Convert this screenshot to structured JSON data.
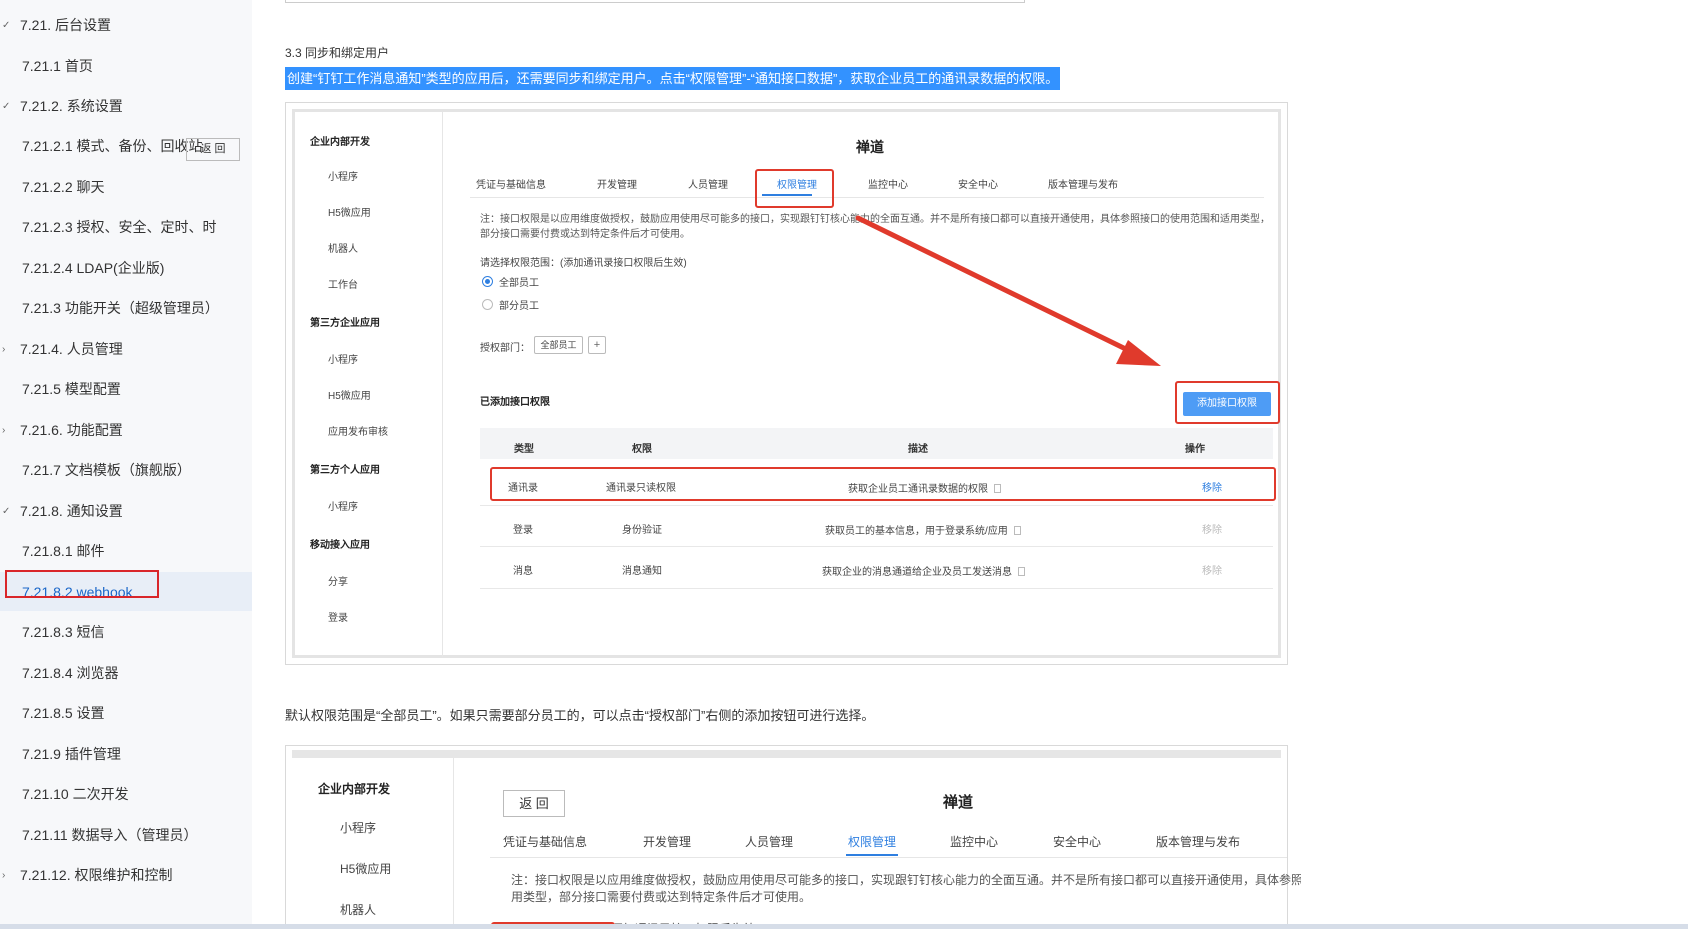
{
  "sidebar": {
    "items": [
      {
        "label": "7.21.  后台设置",
        "level": 1,
        "chevron": "✓"
      },
      {
        "label": "7.21.1  首页",
        "level": 2
      },
      {
        "label": "7.21.2.  系统设置",
        "level": 1,
        "chevron": "✓"
      },
      {
        "label": "7.21.2.1  模式、备份、回收站",
        "level": 2
      },
      {
        "label": "7.21.2.2  聊天",
        "level": 2
      },
      {
        "label": "7.21.2.3  授权、安全、定时、时",
        "level": 2
      },
      {
        "label": "7.21.2.4  LDAP(企业版)",
        "level": 2
      },
      {
        "label": "7.21.3  功能开关（超级管理员）",
        "level": 2
      },
      {
        "label": "7.21.4.  人员管理",
        "level": 1,
        "chevron": "›"
      },
      {
        "label": "7.21.5  模型配置",
        "level": 2
      },
      {
        "label": "7.21.6.  功能配置",
        "level": 1,
        "chevron": "›"
      },
      {
        "label": "7.21.7  文档模板（旗舰版）",
        "level": 2
      },
      {
        "label": "7.21.8.  通知设置",
        "level": 1,
        "chevron": "✓"
      },
      {
        "label": "7.21.8.1  邮件",
        "level": 2
      },
      {
        "label": "7.21.8.2  webhook",
        "level": 2,
        "active": true
      },
      {
        "label": "7.21.8.3  短信",
        "level": 2
      },
      {
        "label": "7.21.8.4  浏览器",
        "level": 2
      },
      {
        "label": "7.21.8.5  设置",
        "level": 2
      },
      {
        "label": "7.21.9  插件管理",
        "level": 2
      },
      {
        "label": "7.21.10  二次开发",
        "level": 2
      },
      {
        "label": "7.21.11  数据导入（管理员）",
        "level": 2
      },
      {
        "label": "7.21.12.  权限维护和控制",
        "level": 1,
        "chevron": "›"
      }
    ]
  },
  "content": {
    "section_heading": "3.3 同步和绑定用户",
    "highlight": "创建“钉钉工作消息通知”类型的应用后，还需要同步和绑定用户。点击“权限管理”-“通知接口数据”，获取企业员工的通讯录数据的权限。",
    "paragraph": "默认权限范围是“全部员工”。如果只需要部分员工的，可以点击“授权部门”右侧的添加按钮可进行选择。"
  },
  "shot1": {
    "left_menu": {
      "g1": "企业内部开发",
      "g1_items": [
        "小程序",
        "H5微应用",
        "机器人",
        "工作台"
      ],
      "g2": "第三方企业应用",
      "g2_items": [
        "小程序",
        "H5微应用",
        "应用发布审核"
      ],
      "g3": "第三方个人应用",
      "g3_items": [
        "小程序"
      ],
      "g4": "移动接入应用",
      "g4_items": [
        "分享",
        "登录"
      ]
    },
    "back": "返 回",
    "title": "禅道",
    "tabs": [
      "凭证与基础信息",
      "开发管理",
      "人员管理",
      "权限管理",
      "监控中心",
      "安全中心",
      "版本管理与发布"
    ],
    "note": "注：接口权限是以应用维度做授权，鼓励应用使用尽可能多的接口，实现跟钉钉核心能力的全面互通。并不是所有接口都可以直接开通使用，具体参照接口的使用范围和适用类型，部分接口需要付费或达到特定条件后才可使用。",
    "scope_label": "请选择权限范围：(添加通讯录接口权限后生效)",
    "radio_all": "全部员工",
    "radio_part": "部分员工",
    "dept_label": "授权部门：",
    "dept_tag": "全部员工",
    "plus": "+",
    "added_label": "已添加接口权限",
    "add_button": "添加接口权限",
    "headers": [
      "类型",
      "权限",
      "描述",
      "操作"
    ],
    "rows": [
      {
        "type": "通讯录",
        "perm": "通讯录只读权限",
        "desc": "获取企业员工通讯录数据的权限",
        "op": "移除"
      },
      {
        "type": "登录",
        "perm": "身份验证",
        "desc": "获取员工的基本信息，用于登录系统/应用",
        "op": "移除"
      },
      {
        "type": "消息",
        "perm": "消息通知",
        "desc": "获取企业的消息通道给企业及员工发送消息",
        "op": "移除"
      }
    ]
  },
  "shot2": {
    "left_menu": {
      "g1": "企业内部开发",
      "items": [
        "小程序",
        "H5微应用",
        "机器人"
      ]
    },
    "back": "返 回",
    "title": "禅道",
    "tabs": [
      "凭证与基础信息",
      "开发管理",
      "人员管理",
      "权限管理",
      "监控中心",
      "安全中心",
      "版本管理与发布"
    ],
    "note_line1": "注：接口权限是以应用维度做授权，鼓励应用使用尽可能多的接口，实现跟钉钉核心能力的全面互通。并不是所有接口都可以直接开通使用，具体参照",
    "note_line2": "用类型，部分接口需要付费或达到特定条件后才可使用。",
    "scope_label": "请选择权限范围：(添加通讯录接口权限后生效)"
  },
  "colors": {
    "accent": "#2f7fe0",
    "highlight": "#3392ff",
    "annotation_red": "#e03a2c"
  }
}
